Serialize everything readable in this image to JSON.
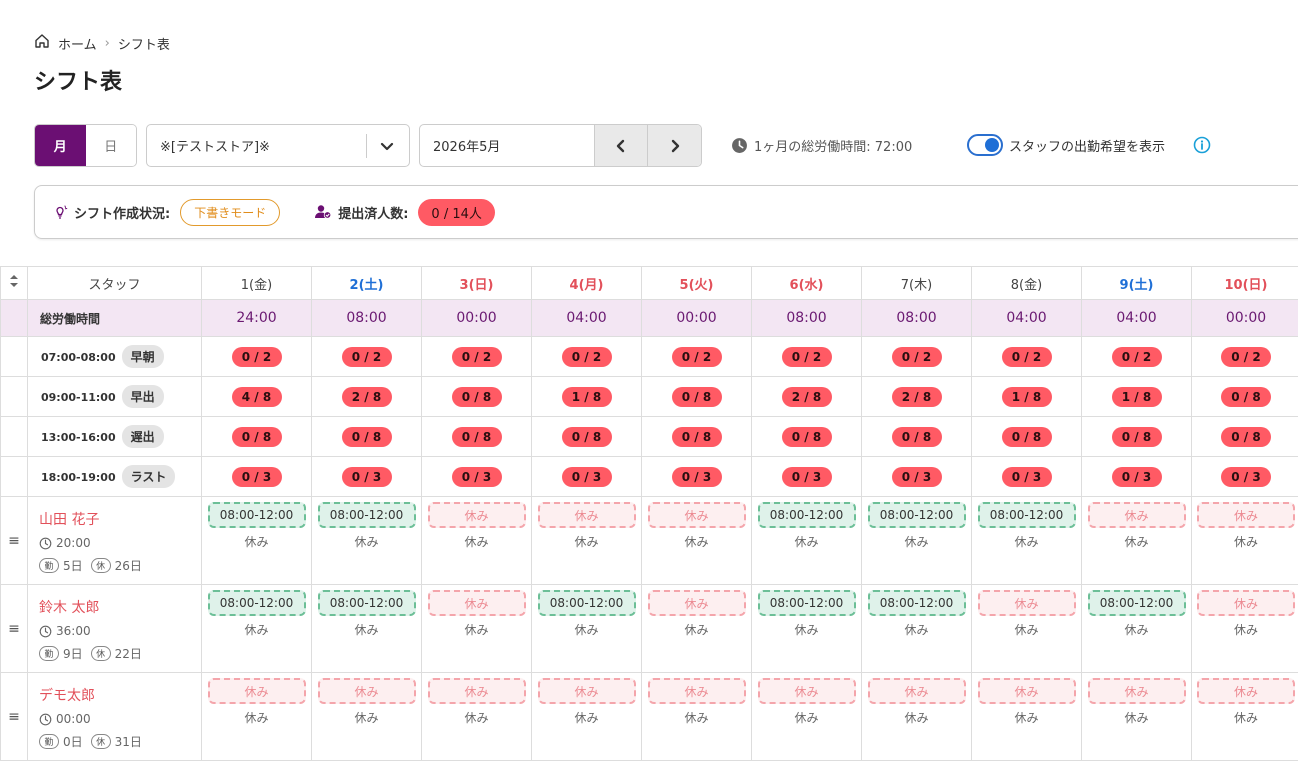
{
  "breadcrumb": {
    "home": "ホーム",
    "current": "シフト表"
  },
  "title": "シフト表",
  "toolbar": {
    "view_month": "月",
    "view_day": "日",
    "store": "※[テストストア]※",
    "month": "2026年5月",
    "total_hours": "1ヶ月の総労働時間: 72:00",
    "toggle_label": "スタッフの出勤希望を表示",
    "toggle_on": true
  },
  "status": {
    "creation_label": "シフト作成状況:",
    "mode": "下書きモード",
    "submitted_label": "提出済人数:",
    "submitted_count": "0 / 14人"
  },
  "table": {
    "staff_header": "スタッフ",
    "days": [
      {
        "label": "1(金)",
        "type": "normal"
      },
      {
        "label": "2(土)",
        "type": "sat"
      },
      {
        "label": "3(日)",
        "type": "hol"
      },
      {
        "label": "4(月)",
        "type": "hol"
      },
      {
        "label": "5(火)",
        "type": "hol"
      },
      {
        "label": "6(水)",
        "type": "hol"
      },
      {
        "label": "7(木)",
        "type": "normal"
      },
      {
        "label": "8(金)",
        "type": "normal"
      },
      {
        "label": "9(土)",
        "type": "sat"
      },
      {
        "label": "10(日)",
        "type": "hol"
      }
    ],
    "total_label": "総労働時間",
    "totals": [
      "24:00",
      "08:00",
      "00:00",
      "04:00",
      "00:00",
      "08:00",
      "08:00",
      "04:00",
      "04:00",
      "00:00"
    ],
    "slots": [
      {
        "time": "07:00-08:00",
        "name": "早朝",
        "values": [
          "0 / 2",
          "0 / 2",
          "0 / 2",
          "0 / 2",
          "0 / 2",
          "0 / 2",
          "0 / 2",
          "0 / 2",
          "0 / 2",
          "0 / 2"
        ]
      },
      {
        "time": "09:00-11:00",
        "name": "早出",
        "values": [
          "4 / 8",
          "2 / 8",
          "0 / 8",
          "1 / 8",
          "0 / 8",
          "2 / 8",
          "2 / 8",
          "1 / 8",
          "1 / 8",
          "0 / 8"
        ]
      },
      {
        "time": "13:00-16:00",
        "name": "遅出",
        "values": [
          "0 / 8",
          "0 / 8",
          "0 / 8",
          "0 / 8",
          "0 / 8",
          "0 / 8",
          "0 / 8",
          "0 / 8",
          "0 / 8",
          "0 / 8"
        ]
      },
      {
        "time": "18:00-19:00",
        "name": "ラスト",
        "values": [
          "0 / 3",
          "0 / 3",
          "0 / 3",
          "0 / 3",
          "0 / 3",
          "0 / 3",
          "0 / 3",
          "0 / 3",
          "0 / 3",
          "0 / 3"
        ]
      }
    ],
    "work_badge": "勤",
    "off_badge": "休",
    "staff": [
      {
        "name": "山田 花子",
        "hours": "20:00",
        "work_days": "5日",
        "off_days": "26日",
        "requests": [
          "08:00-12:00",
          "08:00-12:00",
          "休み",
          "休み",
          "休み",
          "08:00-12:00",
          "08:00-12:00",
          "08:00-12:00",
          "休み",
          "休み"
        ],
        "assigned": [
          "休み",
          "休み",
          "休み",
          "休み",
          "休み",
          "休み",
          "休み",
          "休み",
          "休み",
          "休み"
        ]
      },
      {
        "name": "鈴木 太郎",
        "hours": "36:00",
        "work_days": "9日",
        "off_days": "22日",
        "requests": [
          "08:00-12:00",
          "08:00-12:00",
          "休み",
          "08:00-12:00",
          "休み",
          "08:00-12:00",
          "08:00-12:00",
          "休み",
          "08:00-12:00",
          "休み"
        ],
        "assigned": [
          "休み",
          "休み",
          "休み",
          "休み",
          "休み",
          "休み",
          "休み",
          "休み",
          "休み",
          "休み"
        ]
      },
      {
        "name": "デモ太郎",
        "hours": "00:00",
        "work_days": "0日",
        "off_days": "31日",
        "requests": [
          "休み",
          "休み",
          "休み",
          "休み",
          "休み",
          "休み",
          "休み",
          "休み",
          "休み",
          "休み"
        ],
        "assigned": [
          "休み",
          "休み",
          "休み",
          "休み",
          "休み",
          "休み",
          "休み",
          "休み",
          "休み",
          "休み"
        ]
      }
    ]
  },
  "colors": {
    "primary": "#6b0f73",
    "badge_red": "#ff5a64",
    "saturday": "#1f6fd6",
    "holiday": "#e2505a"
  }
}
